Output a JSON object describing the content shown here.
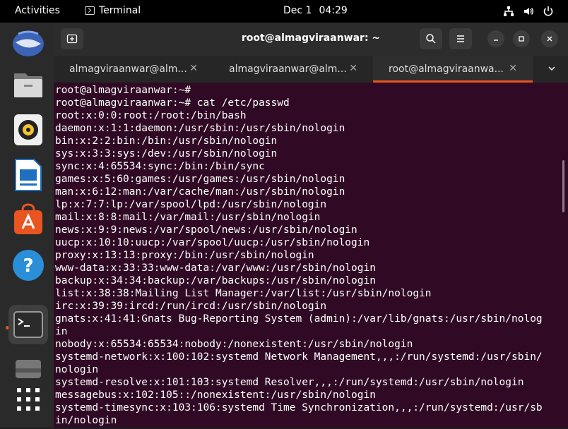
{
  "topbar": {
    "activities": "Activities",
    "app_name": "Terminal",
    "date": "Dec 1",
    "time": "04:29",
    "tray_icons": [
      "network-icon",
      "volume-icon",
      "power-icon"
    ]
  },
  "dock": {
    "items": [
      "thunderbird-icon",
      "files-icon",
      "rhythmbox-icon",
      "writer-icon",
      "software-icon",
      "help-icon",
      "terminal-icon",
      "drive-icon",
      "apps-grid-icon"
    ]
  },
  "window": {
    "title": "root@almagviraanwar: ~",
    "tabs": [
      {
        "label": "almagviraanwar@alm..."
      },
      {
        "label": "almagviraanwar@alm..."
      },
      {
        "label": "root@almagviraanwa..."
      }
    ]
  },
  "terminal": {
    "lines": [
      "root@almagviraanwar:~#",
      "root@almagviraanwar:~# cat /etc/passwd",
      "root:x:0:0:root:/root:/bin/bash",
      "daemon:x:1:1:daemon:/usr/sbin:/usr/sbin/nologin",
      "bin:x:2:2:bin:/bin:/usr/sbin/nologin",
      "sys:x:3:3:sys:/dev:/usr/sbin/nologin",
      "sync:x:4:65534:sync:/bin:/bin/sync",
      "games:x:5:60:games:/usr/games:/usr/sbin/nologin",
      "man:x:6:12:man:/var/cache/man:/usr/sbin/nologin",
      "lp:x:7:7:lp:/var/spool/lpd:/usr/sbin/nologin",
      "mail:x:8:8:mail:/var/mail:/usr/sbin/nologin",
      "news:x:9:9:news:/var/spool/news:/usr/sbin/nologin",
      "uucp:x:10:10:uucp:/var/spool/uucp:/usr/sbin/nologin",
      "proxy:x:13:13:proxy:/bin:/usr/sbin/nologin",
      "www-data:x:33:33:www-data:/var/www:/usr/sbin/nologin",
      "backup:x:34:34:backup:/var/backups:/usr/sbin/nologin",
      "list:x:38:38:Mailing List Manager:/var/list:/usr/sbin/nologin",
      "irc:x:39:39:ircd:/run/ircd:/usr/sbin/nologin",
      "gnats:x:41:41:Gnats Bug-Reporting System (admin):/var/lib/gnats:/usr/sbin/nolog",
      "in",
      "nobody:x:65534:65534:nobody:/nonexistent:/usr/sbin/nologin",
      "systemd-network:x:100:102:systemd Network Management,,,:/run/systemd:/usr/sbin/",
      "nologin",
      "systemd-resolve:x:101:103:systemd Resolver,,,:/run/systemd:/usr/sbin/nologin",
      "messagebus:x:102:105::/nonexistent:/usr/sbin/nologin",
      "systemd-timesync:x:103:106:systemd Time Synchronization,,,:/run/systemd:/usr/sb",
      "in/nologin"
    ]
  },
  "colors": {
    "terminal_bg": "#300a24",
    "accent": "#e95420"
  }
}
